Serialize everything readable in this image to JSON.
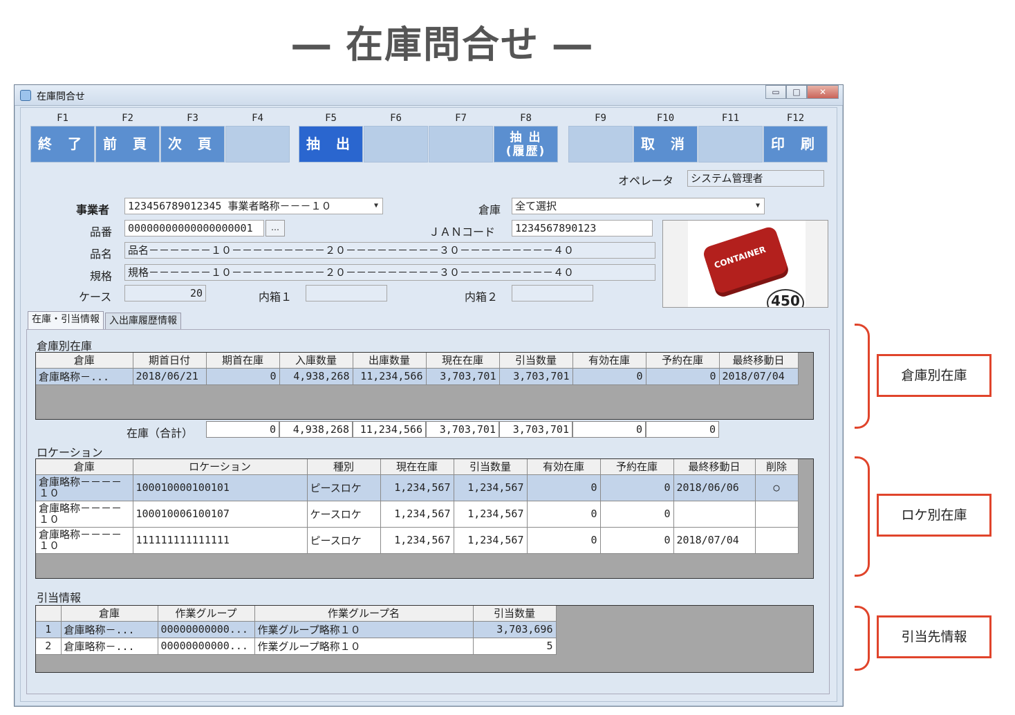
{
  "page_title": "― 在庫問合せ ―",
  "window": {
    "title": "在庫問合せ",
    "controls": {
      "minimize": "▭",
      "maximize": "□",
      "close": "✕"
    }
  },
  "fkeys": [
    {
      "key": "F1",
      "label": "終 了",
      "state": "active"
    },
    {
      "key": "F2",
      "label": "前 頁",
      "state": "active"
    },
    {
      "key": "F3",
      "label": "次 頁",
      "state": "active"
    },
    {
      "key": "F4",
      "label": "",
      "state": "disabled"
    },
    {
      "key": "F5",
      "label": "抽 出",
      "state": "selected"
    },
    {
      "key": "F6",
      "label": "",
      "state": "disabled"
    },
    {
      "key": "F7",
      "label": "",
      "state": "disabled"
    },
    {
      "key": "F8",
      "label": "抽 出\n(履歴)",
      "state": "active"
    },
    {
      "key": "F9",
      "label": "",
      "state": "disabled"
    },
    {
      "key": "F10",
      "label": "取 消",
      "state": "active"
    },
    {
      "key": "F11",
      "label": "",
      "state": "disabled"
    },
    {
      "key": "F12",
      "label": "印 刷",
      "state": "active"
    }
  ],
  "operator": {
    "label": "オペレータ",
    "value": "システム管理者"
  },
  "form": {
    "business_label": "事業者",
    "business_value": "123456789012345 事業者略称－－－１０",
    "warehouse_label": "倉庫",
    "warehouse_value": "全て選択",
    "item_no_label": "品番",
    "item_no_value": "00000000000000000001",
    "ellipsis": "…",
    "jan_label": "ＪＡＮコード",
    "jan_value": "1234567890123",
    "name_label": "品名",
    "name_value": "品名－－－－－－１０－－－－－－－－－２０－－－－－－－－－３０－－－－－－－－－４０",
    "spec_label": "規格",
    "spec_value": "規格－－－－－－１０－－－－－－－－－２０－－－－－－－－－３０－－－－－－－－－４０",
    "case_label": "ケース",
    "case_value": "20",
    "inner1_label": "内箱１",
    "inner1_value": "",
    "inner2_label": "内箱２",
    "inner2_value": ""
  },
  "photo": {
    "container_text": "CONTAINER",
    "badge": "450"
  },
  "tabs": [
    "在庫・引当情報",
    "入出庫履歴情報"
  ],
  "warehouse_stock": {
    "title": "倉庫別在庫",
    "headers": [
      "倉庫",
      "期首日付",
      "期首在庫",
      "入庫数量",
      "出庫数量",
      "現在在庫",
      "引当数量",
      "有効在庫",
      "予約在庫",
      "最終移動日"
    ],
    "rows": [
      [
        "倉庫略称－...",
        "2018/06/21",
        "0",
        "4,938,268",
        "11,234,566",
        "3,703,701",
        "3,703,701",
        "0",
        "0",
        "2018/07/04"
      ]
    ],
    "total_label": "在庫（合計）",
    "totals": [
      "0",
      "4,938,268",
      "11,234,566",
      "3,703,701",
      "3,703,701",
      "0",
      "0"
    ]
  },
  "location": {
    "title": "ロケーション",
    "headers": [
      "倉庫",
      "ロケーション",
      "種別",
      "現在在庫",
      "引当数量",
      "有効在庫",
      "予約在庫",
      "最終移動日",
      "削除"
    ],
    "rows": [
      [
        "倉庫略称－－－－１０",
        "100010000100101",
        "ピースロケ",
        "1,234,567",
        "1,234,567",
        "0",
        "0",
        "2018/06/06",
        "○"
      ],
      [
        "倉庫略称－－－－１０",
        "100010006100107",
        "ケースロケ",
        "1,234,567",
        "1,234,567",
        "0",
        "0",
        "",
        ""
      ],
      [
        "倉庫略称－－－－１０",
        "111111111111111",
        "ピースロケ",
        "1,234,567",
        "1,234,567",
        "0",
        "0",
        "2018/07/04",
        ""
      ]
    ]
  },
  "allocation": {
    "title": "引当情報",
    "headers": [
      "",
      "倉庫",
      "作業グループ",
      "作業グループ名",
      "引当数量"
    ],
    "rows": [
      [
        "1",
        "倉庫略称－...",
        "00000000000...",
        "作業グループ略称１０",
        "3,703,696"
      ],
      [
        "2",
        "倉庫略称－...",
        "00000000000...",
        "作業グループ略称１０",
        "5"
      ]
    ]
  },
  "annotations": [
    "倉庫別在庫",
    "ロケ別在庫",
    "引当先情報"
  ],
  "colors": {
    "fkey_active": "#5b8fd0",
    "fkey_selected": "#2a66cf",
    "fkey_disabled": "#b7cde7",
    "annotation": "#e0442b",
    "row_selected": "#c3d4ea"
  }
}
